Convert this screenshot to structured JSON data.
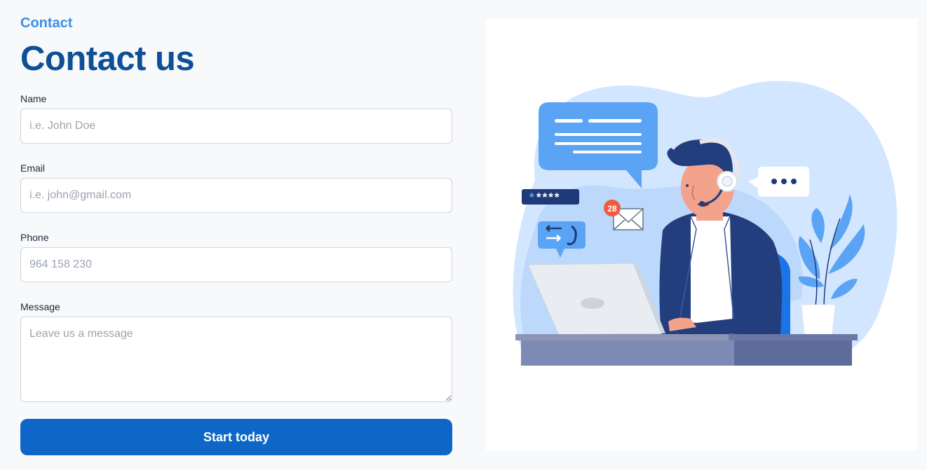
{
  "header": {
    "eyebrow": "Contact",
    "title": "Contact us"
  },
  "form": {
    "name": {
      "label": "Name",
      "placeholder": "i.e. John Doe"
    },
    "email": {
      "label": "Email",
      "placeholder": "i.e. john@gmail.com"
    },
    "phone": {
      "label": "Phone",
      "placeholder": "964 158 230"
    },
    "message": {
      "label": "Message",
      "placeholder": "Leave us a message"
    },
    "submit_label": "Start today"
  },
  "illustration": {
    "password_mask": "****",
    "notification_count": "28",
    "colors": {
      "accent": "#0e67c6",
      "eyebrow": "#3b8fe8",
      "title": "#0e4f96"
    }
  }
}
